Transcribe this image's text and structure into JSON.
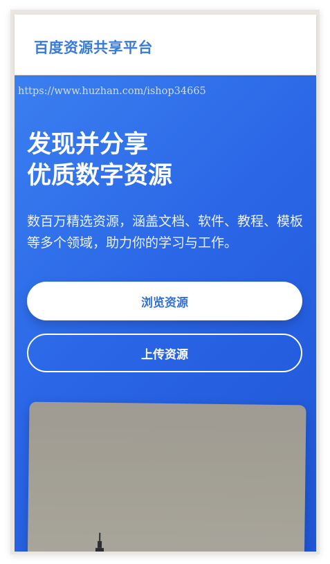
{
  "header": {
    "brand": "百度资源共享平台"
  },
  "watermark": "https://www.huzhan.com/ishop34665",
  "hero": {
    "title_line1": "发现并分享",
    "title_line2": "优质数字资源",
    "description": "数百万精选资源，涵盖文档、软件、教程、模板等多个领域，助力你的学习与工作。",
    "browse_button": "浏览资源",
    "upload_button": "上传资源"
  },
  "colors": {
    "brand": "#3a7bd8",
    "hero_gradient_start": "#3b7ff0",
    "hero_gradient_end": "#1f55d6",
    "primary_button_text": "#3270dd"
  },
  "image": {
    "subject": "city-skyline-photo"
  }
}
